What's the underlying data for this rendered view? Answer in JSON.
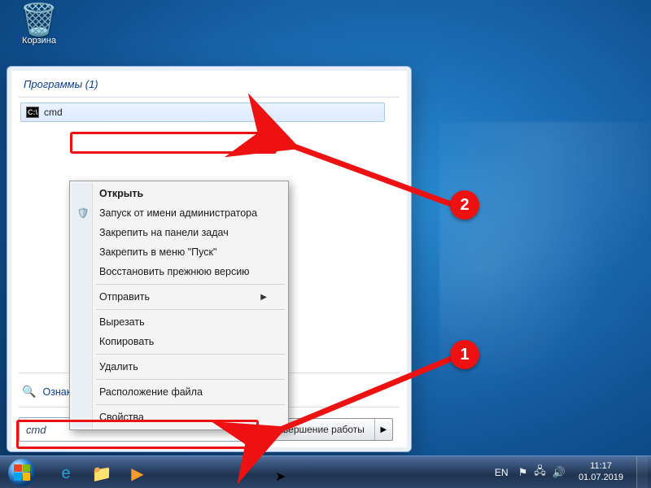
{
  "desktop_icon": {
    "label": "Корзина"
  },
  "start_menu": {
    "programs_heading": "Программы (1)",
    "result_label": "cmd",
    "more_results": "Ознакомиться с другими результатами",
    "search_value": "cmd",
    "shutdown_label": "Завершение работы"
  },
  "context_menu": {
    "open": "Открыть",
    "run_admin": "Запуск от имени администратора",
    "pin_taskbar": "Закрепить на панели задач",
    "pin_start": "Закрепить в меню \"Пуск\"",
    "restore_prev": "Восстановить прежнюю версию",
    "send_to": "Отправить",
    "cut": "Вырезать",
    "copy": "Копировать",
    "delete": "Удалить",
    "file_location": "Расположение файла",
    "properties": "Свойства"
  },
  "annotation": {
    "step1": "1",
    "step2": "2"
  },
  "taskbar": {
    "language": "EN",
    "time": "11:17",
    "date": "01.07.2019"
  }
}
